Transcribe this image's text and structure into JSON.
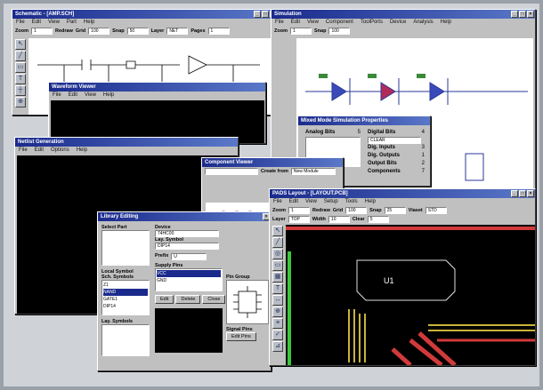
{
  "pads": {
    "title": "PADS Layout - [LAYOUT.PCB]",
    "menu": [
      "File",
      "Edit",
      "View",
      "Setup",
      "Tools",
      "Help"
    ],
    "toolbar": {
      "zoom_label": "Zoom",
      "zoom_value": "1",
      "redraw": "Redraw",
      "grid": "Grid",
      "grid_value": "100",
      "snap": "Snap",
      "snap_value": "25",
      "layer": "Layer",
      "layer_value": "TOP",
      "width": "Width",
      "width_value": "10",
      "clear": "Clear",
      "clear_value": "5",
      "viaset": "Viaset",
      "viaset_value": "STD"
    },
    "ref_label": "U1"
  },
  "schematic": {
    "title": "Schematic - [AMP.SCH]",
    "menu": [
      "File",
      "Edit",
      "View",
      "Part",
      "Help"
    ],
    "toolbar": {
      "zoom_label": "Zoom",
      "zoom_value": "1",
      "redraw": "Redraw",
      "grid": "Grid",
      "grid_value": "100",
      "snap": "Snap",
      "snap_value": "50",
      "layer": "Layer",
      "layer_value": "NET",
      "pages": "Pages",
      "pages_value": "1"
    }
  },
  "simulator": {
    "title": "Simulation",
    "menu": [
      "File",
      "Edit",
      "View",
      "Component",
      "ToolPorts",
      "Device",
      "Analysis",
      "Help"
    ],
    "toolbar": {
      "zoom_label": "Zoom",
      "zoom_value": "1",
      "snap": "Snap",
      "snap_value": "100"
    }
  },
  "mixed_mode": {
    "title": "Mixed Mode Simulation Properties",
    "rows": [
      {
        "k": "Analog Bits",
        "v": "5"
      },
      {
        "k": "Digital Bits",
        "v": "4"
      },
      {
        "k": "Dig. Inputs",
        "v": "3"
      },
      {
        "k": "Dig. Outputs",
        "v": "1"
      },
      {
        "k": "Output Bits",
        "v": "2"
      },
      {
        "k": "Components",
        "v": "7"
      }
    ],
    "select_value": "CLEAR"
  },
  "waveform": {
    "title": "Waveform Viewer",
    "menu": [
      "File",
      "Edit",
      "View",
      "Help"
    ]
  },
  "netlist": {
    "title": "Netlist Generation",
    "menu": [
      "File",
      "Edit",
      "Options",
      "Help"
    ]
  },
  "viewer": {
    "title": "Component Viewer",
    "create_from": "Create from",
    "create_value": "New Module"
  },
  "library": {
    "title": "Library Editing",
    "labels": {
      "select_part": "Select Part",
      "device": "Device",
      "lay_symbol": "Lay. Symbol",
      "prefix": "Prefix",
      "supply_pins": "Supply Pins",
      "pin_group": "Pin Group",
      "local_symbols": "Local Symbol",
      "sch_symbols": "Sch. Symbols",
      "lay_symbols": "Lay. Symbols",
      "signal_pins": "Signal Pins",
      "symbol_pins": "Symbol Pins"
    },
    "device_value": "74HC00",
    "lay_value": "DIP14",
    "prefix_value": "U",
    "symbols": [
      "Z1",
      "NAND",
      "GATE1",
      "DIP14"
    ],
    "selected_symbol": "NAND",
    "buttons": [
      "Edit",
      "Delete",
      "Close"
    ],
    "bottom_button": "Edit Pins",
    "supply_values": [
      "VCC",
      "GND"
    ]
  }
}
